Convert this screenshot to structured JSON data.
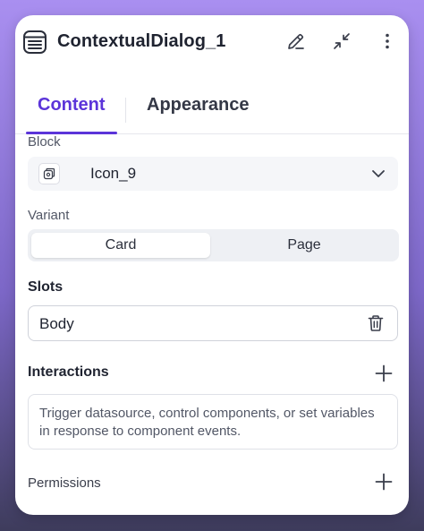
{
  "header": {
    "title": "ContextualDialog_1"
  },
  "tabs": [
    {
      "label": "Content",
      "active": true
    },
    {
      "label": "Appearance",
      "active": false
    }
  ],
  "block": {
    "label": "Block",
    "value": "Icon_9"
  },
  "variant": {
    "label": "Variant",
    "options": [
      "Card",
      "Page"
    ],
    "selected": "Card"
  },
  "slots": {
    "title": "Slots",
    "items": [
      {
        "label": "Body"
      }
    ]
  },
  "interactions": {
    "title": "Interactions",
    "description": "Trigger datasource, control components, or set variables in response to component events."
  },
  "permissions": {
    "label": "Permissions"
  },
  "icons": {
    "doc": "document-icon",
    "edit": "pencil-icon",
    "collapse": "collapse-icon",
    "more": "more-vertical-icon",
    "block": "block-icon",
    "chevron": "chevron-down-icon",
    "trash": "trash-icon",
    "add": "plus-icon"
  },
  "colors": {
    "accent": "#5b34d9",
    "text": "#1f2330",
    "muted": "#525766"
  }
}
